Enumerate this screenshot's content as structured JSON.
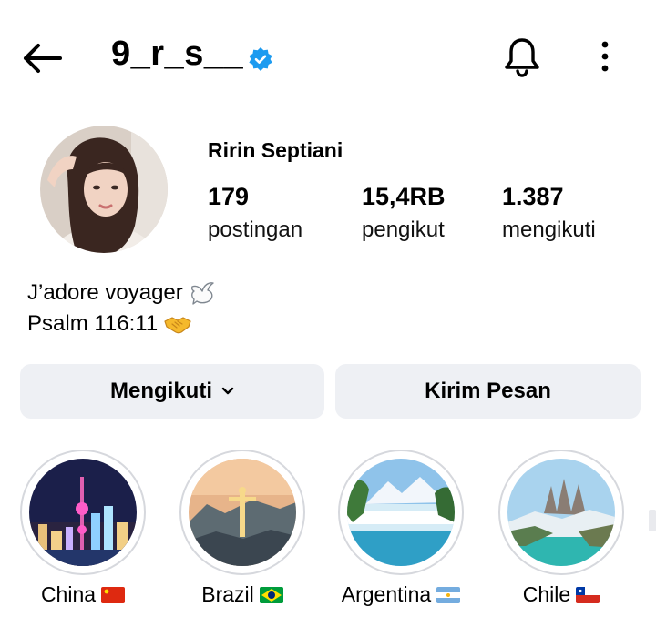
{
  "header": {
    "username": "9_r_s__"
  },
  "profile": {
    "full_name": "Ririn Septiani",
    "stats": [
      {
        "value": "179",
        "label": "postingan"
      },
      {
        "value": "15,4RB",
        "label": "pengikut"
      },
      {
        "value": "1.387",
        "label": "mengikuti"
      }
    ],
    "bio": [
      "J’adore voyager",
      "Psalm 116:11"
    ]
  },
  "actions": {
    "follow_label": "Mengikuti",
    "message_label": "Kirim Pesan"
  },
  "highlights": [
    {
      "label": "China"
    },
    {
      "label": "Brazil"
    },
    {
      "label": "Argentina"
    },
    {
      "label": "Chile"
    }
  ],
  "colors": {
    "verified": "#1d9bf0",
    "button_bg": "#eef0f4"
  }
}
